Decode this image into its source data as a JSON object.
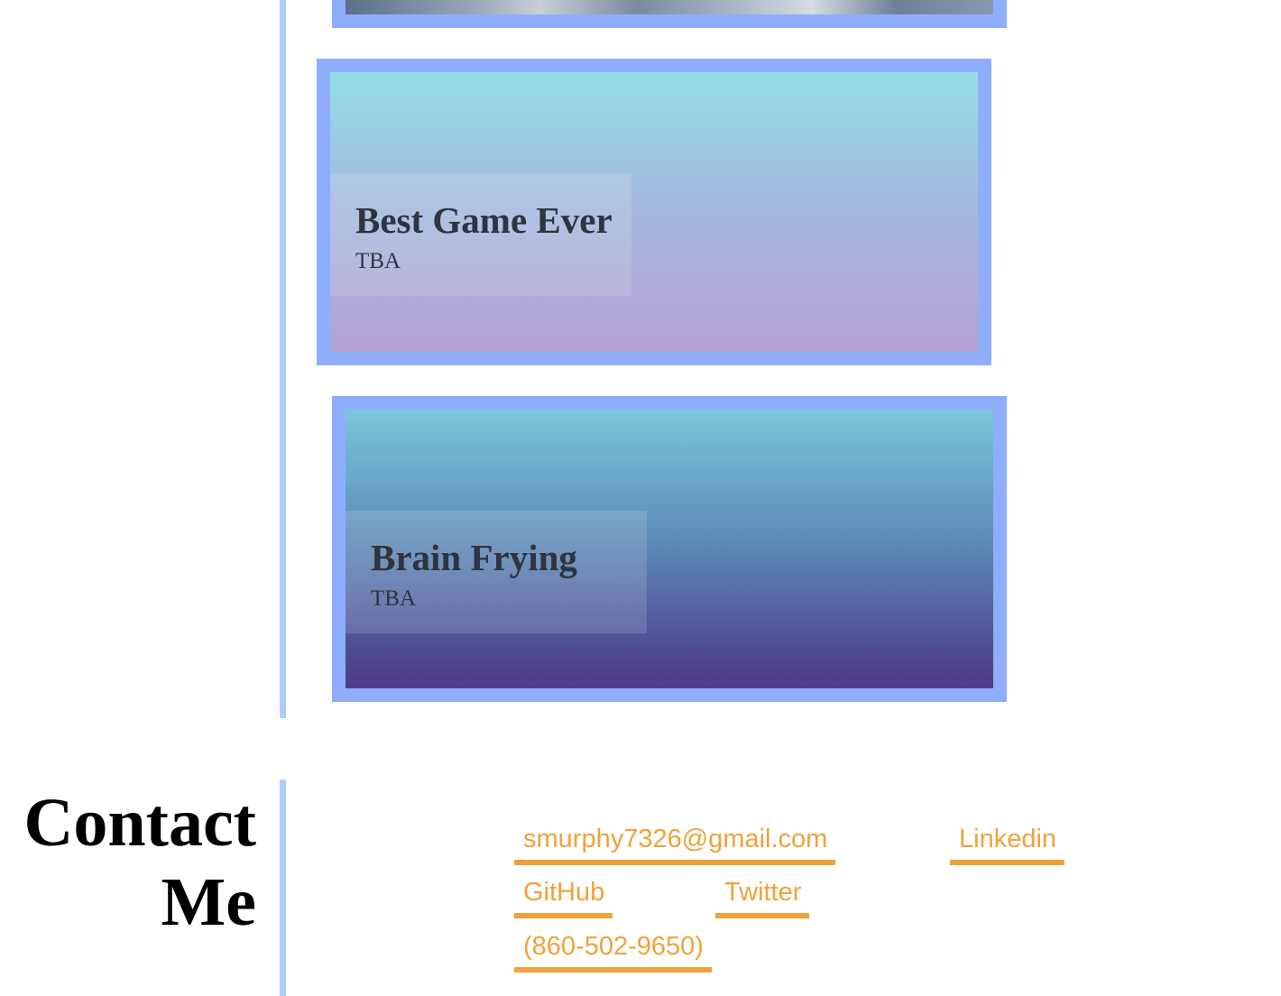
{
  "projects": [
    {
      "title": "Best Game Ever",
      "status": "TBA"
    },
    {
      "title": "Brain Frying",
      "status": "TBA"
    }
  ],
  "contact": {
    "heading_line1": "Contact",
    "heading_line2": "Me",
    "links": {
      "email": "smurphy7326@gmail.com",
      "linkedin": "Linkedin",
      "github": "GitHub",
      "twitter": "Twitter",
      "phone": "(860-502-9650)"
    }
  },
  "colors": {
    "accent_border": "#8eaefc",
    "divider": "#b3c9fb",
    "link": "#f0a23a",
    "caption_text": "#2e3440"
  }
}
